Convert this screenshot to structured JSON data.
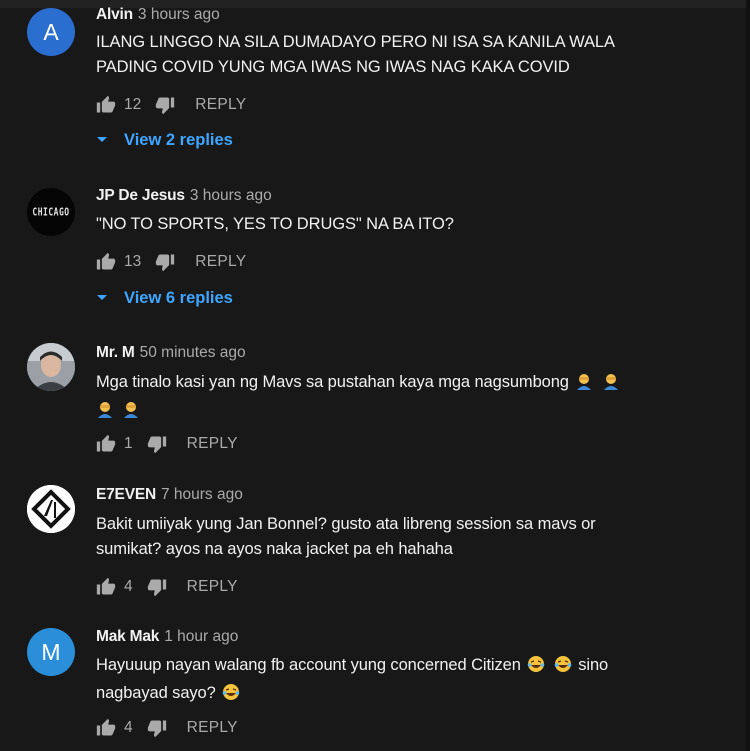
{
  "comments": [
    {
      "author": "Alvin",
      "time": "3 hours ago",
      "avatar_letter": "A",
      "avatar_color": "#2a6fd0",
      "text": "ILANG LINGGO NA SILA DUMADAYO PERO NI ISA SA KANILA WALA PADING COVID YUNG MGA IWAS NG IWAS NAG KAKA COVID",
      "likes": "12",
      "reply_label": "REPLY",
      "view_replies": "View 2 replies"
    },
    {
      "author": "JP De Jesus",
      "time": "3 hours ago",
      "avatar_text": "CHICAGO",
      "text": "\"NO TO SPORTS, YES TO DRUGS\" NA BA ITO?",
      "likes": "13",
      "reply_label": "REPLY",
      "view_replies": "View 6 replies"
    },
    {
      "author": "Mr. M",
      "time": "50 minutes ago",
      "text_part1": "Mga tinalo kasi yan ng Mavs sa pustahan kaya mga nagsumbong",
      "likes": "1",
      "reply_label": "REPLY"
    },
    {
      "author": "E7EVEN",
      "time": "7 hours ago",
      "text_line1": "Bakit umiiyak yung Jan Bonnel? gusto ata libreng session sa mavs or",
      "text_line2": "sumikat? ayos na ayos naka jacket pa eh hahaha",
      "likes": "4",
      "reply_label": "REPLY"
    },
    {
      "author": "Mak Mak",
      "time": "1 hour ago",
      "avatar_letter": "M",
      "avatar_color": "#2a8fd8",
      "text_line1a": "Hayuuup nayan walang fb account yung concerned Citizen",
      "text_line1b": "sino",
      "text_line2": "nagbayad sayo?",
      "likes": "4",
      "reply_label": "REPLY"
    }
  ],
  "colors": {
    "background": "#181818",
    "link": "#3ea6ff",
    "secondary_text": "#aaaaaa"
  },
  "icons": [
    "thumb-up-icon",
    "thumb-down-icon",
    "chevron-down-icon",
    "person-facepalming-emoji",
    "laughing-tears-emoji"
  ]
}
